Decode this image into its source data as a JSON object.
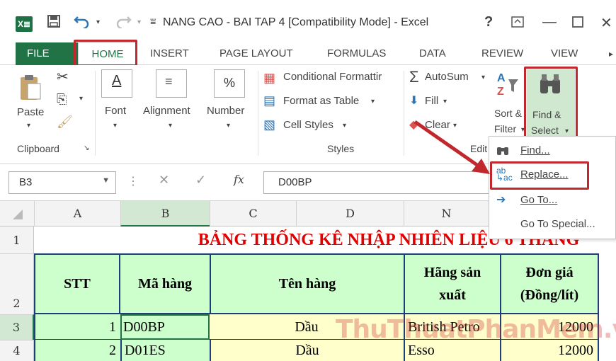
{
  "window": {
    "title": "NANG CAO - BAI TAP 4  [Compatibility Mode] - Excel",
    "help": "?",
    "app_icon": "X≣"
  },
  "tabs": [
    {
      "label": "FILE"
    },
    {
      "label": "HOME"
    },
    {
      "label": "INSERT"
    },
    {
      "label": "PAGE LAYOUT"
    },
    {
      "label": "FORMULAS"
    },
    {
      "label": "DATA"
    },
    {
      "label": "REVIEW"
    },
    {
      "label": "VIEW"
    }
  ],
  "ribbon": {
    "paste": "Paste",
    "clipboard": "Clipboard",
    "font": "Font",
    "alignment": "Alignment",
    "number": "Number",
    "number_symbol": "%",
    "conditional_formatting": "Conditional Formattir",
    "format_as_table": "Format as Table",
    "cell_styles": "Cell Styles",
    "styles": "Styles",
    "autosum": "AutoSum",
    "fill": "Fill",
    "clear": "Clear",
    "editing": "Edit",
    "sort_line1": "Sort &",
    "sort_line2": "Filter",
    "find_line1": "Find &",
    "find_line2": "Select"
  },
  "find_menu": [
    {
      "label": "Find..."
    },
    {
      "label": "Replace..."
    },
    {
      "label": "Go To..."
    },
    {
      "label": "Go To Special..."
    }
  ],
  "formula_bar": {
    "name_box": "B3",
    "fx": "fx",
    "value": "D00BP"
  },
  "columns": [
    "A",
    "B",
    "C",
    "D",
    "N"
  ],
  "rows": [
    "1",
    "2",
    "3",
    "4"
  ],
  "sheet": {
    "title": "BẢNG THỐNG KÊ NHẬP NHIÊN LIỆU 6 THÁNG",
    "headers": {
      "stt": "STT",
      "ma_hang": "Mã hàng",
      "ten_hang": "Tên hàng",
      "hang_sx_line1": "Hãng sản",
      "hang_sx_line2": "xuất",
      "don_gia_line1": "Đơn giá",
      "don_gia_line2": "(Đồng/lít)"
    },
    "data_rows": [
      {
        "stt": "1",
        "ma_hang": "D00BP",
        "ten_hang": "Dầu",
        "hang_sx": "British Petro",
        "don_gia": "12000"
      },
      {
        "stt": "2",
        "ma_hang": "D01ES",
        "ten_hang": "Dầu",
        "hang_sx": "Esso",
        "don_gia": "12000"
      }
    ]
  },
  "watermark": "ThuThuatPhanMem.vn",
  "colors": {
    "excel_green": "#217346",
    "highlight_red": "#c0282d",
    "header_fill": "#ccffcc",
    "data_fill": "#ffffcc",
    "title_red": "#e00000"
  }
}
